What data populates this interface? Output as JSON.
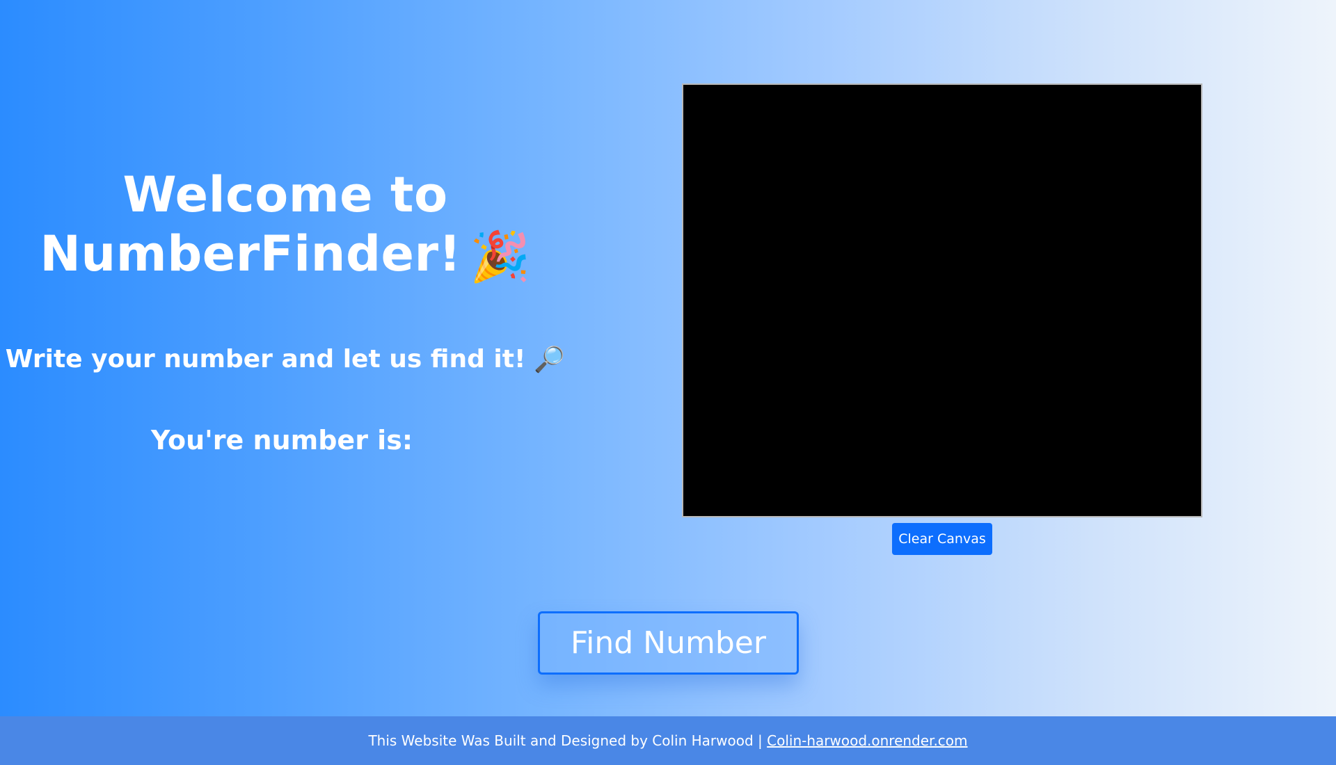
{
  "hero": {
    "title_line1": "Welcome to",
    "title_line2": "NumberFinder!",
    "title_emoji": "🎉",
    "subtitle": "Write your number and let us find it!",
    "subtitle_emoji": "🔎",
    "result_label": "You're number is:",
    "result_value": ""
  },
  "canvas": {
    "background": "#000000",
    "clear_label": "Clear Canvas"
  },
  "actions": {
    "find_label": "Find Number"
  },
  "footer": {
    "text": "This Website Was Built and Designed by Colin Harwood |",
    "link_label": "Colin-harwood.onrender.com"
  },
  "colors": {
    "accent": "#0d6efd",
    "footer_bg": "#4a87e6",
    "gradient_start": "#2b8cff",
    "gradient_end": "#eef4fb"
  }
}
